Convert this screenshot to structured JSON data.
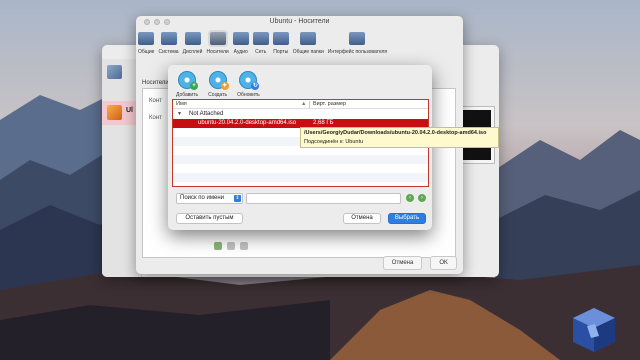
{
  "manager_window": {
    "vm_name_fragment": "Ul",
    "buttons": {
      "cancel": "Отмена",
      "ok": "OK"
    }
  },
  "settings_window": {
    "title": "Ubuntu - Носители",
    "toolbar": [
      {
        "label": "Общие",
        "icon": "general-icon"
      },
      {
        "label": "Система",
        "icon": "system-icon"
      },
      {
        "label": "Дисплей",
        "icon": "display-icon"
      },
      {
        "label": "Носители",
        "icon": "storage-icon",
        "selected": true
      },
      {
        "label": "Аудио",
        "icon": "audio-icon"
      },
      {
        "label": "Сеть",
        "icon": "network-icon"
      },
      {
        "label": "Порты",
        "icon": "ports-icon"
      },
      {
        "label": "Общие папки",
        "icon": "shared-folders-icon"
      },
      {
        "label": "Интерфейс пользователя",
        "icon": "ui-icon"
      }
    ],
    "section_label": "Носители",
    "tree_items": [
      "Конт",
      "Конт"
    ]
  },
  "dialog": {
    "toolbar": [
      {
        "label": "Добавить",
        "icon": "add-disk-icon",
        "badge": "+",
        "badge_color": "#3aa655"
      },
      {
        "label": "Создать",
        "icon": "create-disk-icon",
        "badge": "✦",
        "badge_color": "#f0a030"
      },
      {
        "label": "Обновить",
        "icon": "refresh-disk-icon",
        "badge": "↻",
        "badge_color": "#2f7de1"
      }
    ],
    "columns": {
      "name": "Имя",
      "size": "Вирт. размер"
    },
    "group": "Not Attached",
    "selected_row": {
      "name": "ubuntu-20.04.2.0-desktop-amd64.iso",
      "size": "2,68 ГБ"
    },
    "tooltip": {
      "path": "/Users/GeorgiyDudar/Downloads/ubuntu-20.04.2.0-desktop-amd64.iso",
      "attached": "Подсоединён к: Ubuntu"
    },
    "search": {
      "mode": "Поиск по имени",
      "value": ""
    },
    "buttons": {
      "clear": "Оставить пустым",
      "cancel": "Отмена",
      "choose": "Выбрать"
    }
  },
  "colors": {
    "selection": "#c60f13",
    "accent": "#2f7de1",
    "tooltip_bg": "#fffacd"
  }
}
